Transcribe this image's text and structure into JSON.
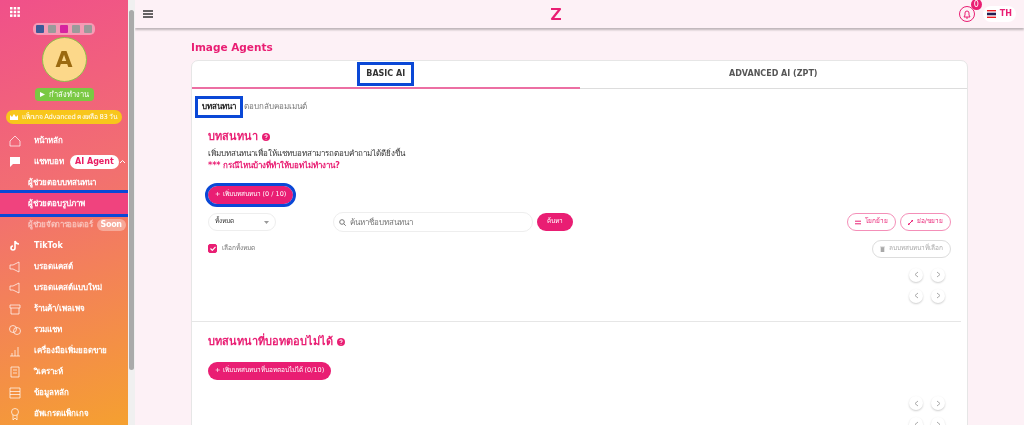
{
  "sidebar": {
    "avatar": "A",
    "status": "กำลังทำงาน",
    "package": "แพ็กเกจ Advanced คงเหลือ 83 วัน",
    "items": [
      {
        "label": "หน้าหลัก",
        "kind": "home",
        "selected": false
      },
      {
        "label": "แชทบอท",
        "kind": "chat",
        "badge": "AI Agent",
        "expanded": true,
        "selected": false,
        "children": [
          {
            "label": "ผู้ช่วยตอบบทสนทนา",
            "selected": false,
            "disabled": false
          },
          {
            "label": "ผู้ช่วยตอบรูปภาพ",
            "selected": true,
            "disabled": false,
            "highlighted": true
          },
          {
            "label": "ผู้ช่วยจัดการออเดอร์",
            "selected": false,
            "disabled": true,
            "badge": "Soon"
          }
        ]
      },
      {
        "label": "TikTok",
        "kind": "tiktok",
        "selected": false
      },
      {
        "label": "บรอดแคสต์",
        "kind": "megaphone",
        "selected": false
      },
      {
        "label": "บรอดแคสต์แบบใหม่",
        "kind": "megaphone",
        "selected": false
      },
      {
        "label": "ร้านค้า/เพลเพจ",
        "kind": "store",
        "selected": false
      },
      {
        "label": "รวมแชท",
        "kind": "bubbles",
        "selected": false
      },
      {
        "label": "เครื่องมือเพิ่มยอดขาย",
        "kind": "chart",
        "selected": false
      },
      {
        "label": "วิเคราะห์",
        "kind": "report",
        "selected": false
      },
      {
        "label": "ข้อมูลหลัก",
        "kind": "list",
        "selected": false
      },
      {
        "label": "อัพเกรดแพ็กเกจ",
        "kind": "medal",
        "selected": false
      }
    ]
  },
  "topbar": {
    "notifications": "0",
    "language": "TH"
  },
  "page_title": "Image Agents",
  "tabs": [
    {
      "label": "BASIC AI",
      "selected": true,
      "highlighted": true
    },
    {
      "label": "ADVANCED AI (ZPT)",
      "selected": false,
      "highlighted": false
    }
  ],
  "subtabs": [
    {
      "label": "บทสนทนา",
      "selected": true,
      "highlighted": true
    },
    {
      "label": "ตอบกลับคอมเมนต์",
      "selected": false,
      "highlighted": false
    }
  ],
  "sections": [
    {
      "title": "บทสนทนา",
      "description": "เพิ่มบทสนทนาเพื่อให้แชทบอทสามารถตอบคำถามได้ดียิ่งขึ้น",
      "help_link": "*** กรณีไหนบ้างที่ทำให้บอทไม่ทำงาน?",
      "add_button": "+ เพิ่มบทสนทนา (0 / 10)",
      "add_highlighted": true,
      "filter": "ทั้งหมด",
      "search_placeholder": "ค้นหาชื่อบทสนทนา",
      "search_button": "ค้นหา",
      "move_button": "โยกย้าย",
      "collapse_button": "ย่อ/ขยาย",
      "select_all": {
        "label": "เลือกทั้งหมด",
        "checked": true
      },
      "delete_button": {
        "label": "ลบบทสนทนาที่เลือก",
        "disabled": true
      }
    },
    {
      "title": "บทสนทนาที่บอทตอบไม่ได้",
      "add_button": "+ เพิ่มบทสนทนาที่บอทตอบไม่ได้ (0/10)",
      "add_highlighted": false
    }
  ]
}
